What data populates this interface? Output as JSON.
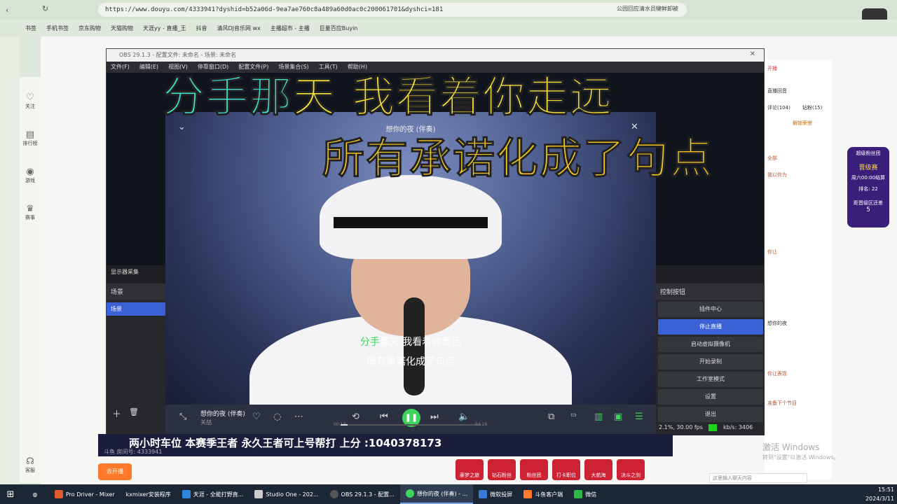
{
  "browser": {
    "url": "https://www.douyu.com/4333941?dyshid=b52a06d-9ea7ae760c8a489a60d0ac0c200061701&dyshci=181",
    "top_right_text": "公园回应清水员犍鲜卸被",
    "bookmarks": [
      "书签",
      "手机书签",
      "京东购物",
      "天猫购物",
      "天涯yy - 直播_王",
      "抖音",
      "清风DJ音乐网 wx",
      "主播超市 - 主播",
      "巨量百应Buyin"
    ]
  },
  "page_sidebar": {
    "items": [
      {
        "icon": "heart-icon",
        "label": "关注"
      },
      {
        "icon": "rank-icon",
        "label": "排行榜"
      },
      {
        "icon": "game-icon",
        "label": "游戏"
      },
      {
        "icon": "trophy-icon",
        "label": "赛事"
      },
      {
        "icon": "service-icon",
        "label": "客服"
      }
    ]
  },
  "obs": {
    "title": "OBS 29.1.3 - 配置文件: 未命名 - 场景: 未命名",
    "menu": [
      "文件(F)",
      "编辑(E)",
      "视图(V)",
      "停靠窗口(D)",
      "配置文件(P)",
      "场景集合(S)",
      "工具(T)",
      "帮助(H)"
    ],
    "display_capture": "显示器采集",
    "scenes_header": "场景",
    "scene_item": "场景",
    "controls_header": "控制按钮",
    "controls": [
      "插件中心",
      "停止直播",
      "启动虚拟摄像机",
      "开始录制",
      "工作室模式",
      "设置",
      "退出"
    ],
    "status": "2.1%, 30.00 fps",
    "bitrate": "kb/s: 3406"
  },
  "player": {
    "title": "想你的夜 (伴奏)",
    "lyric_line1_highlight": "分手",
    "lyric_line1_rest": "那天 我看着你走远",
    "lyric_line2": "所有承诺化成了句点",
    "song_name": "想你的夜 (伴奏)",
    "artist": "关喆",
    "time_now": "00:13",
    "time_total": "04:26",
    "progress": 0.05
  },
  "big_lyrics": {
    "line1_highlight": "分手那",
    "line1_rest": "天 我看着你走远",
    "line2": "所有承诺化成了句点"
  },
  "chat": {
    "lines": [
      "开播",
      "直播回音",
      "评论(104)",
      "钻粉(15)",
      "解锁荣誉",
      "全部",
      "我以你为",
      "想你的夜",
      "你让",
      "你让表现",
      "准备下个节目"
    ]
  },
  "rank_card": {
    "title": "超级粉丝团",
    "event": "晋级赛",
    "time": "周六00:00结算",
    "rank_label": "排名: 22",
    "gap_label": "距晋级区还差",
    "gap": "5"
  },
  "banner": {
    "text": "两小时车位  本赛季王者  永久王者可上号帮打  上分 :1040378173",
    "room_id": "斗鱼 房间号: 4333941",
    "open_live": "去开播"
  },
  "gifts": [
    "豪梦之旅",
    "钻石粉丝",
    "粉丝团",
    "打卡职位",
    "大航海",
    "决斗之剑"
  ],
  "windows_watermark": {
    "line1": "激活 Windows",
    "line2": "转到\"设置\"以激活 Windows。"
  },
  "chat_input_placeholder": "这里输入聊天内容",
  "taskbar": {
    "items": [
      "Pro Driver - Mixer",
      "kxmixer安装程序",
      "天涯 - 全能打野直...",
      "Studio One - 202...",
      "OBS 29.1.3 - 配置...",
      "想你的夜 (伴奏) - ...",
      "微软投屏",
      "斗鱼客户端",
      "微信"
    ],
    "active_index": 5,
    "time": "15:51",
    "date": "2024/3/11"
  }
}
